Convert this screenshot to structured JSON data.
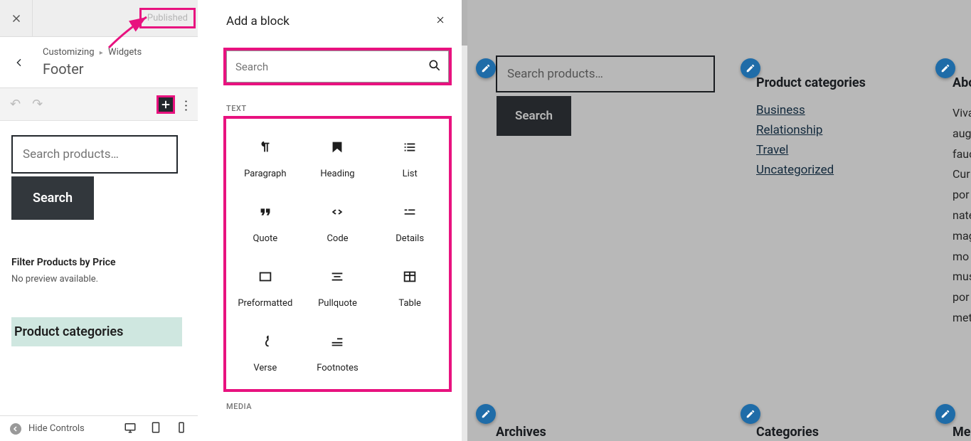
{
  "customizer": {
    "published_label": "Published",
    "breadcrumb1": "Customizing",
    "breadcrumb2": "Widgets",
    "section_title": "Footer",
    "hide_controls": "Hide Controls"
  },
  "sidebar_widgets": {
    "search_placeholder": "Search products…",
    "search_button": "Search",
    "filter_title": "Filter Products by Price",
    "filter_message": "No preview available.",
    "categories_title": "Product categories"
  },
  "block_panel": {
    "title": "Add a block",
    "search_placeholder": "Search",
    "section_text": "TEXT",
    "section_media": "MEDIA",
    "blocks": [
      {
        "name": "Paragraph",
        "icon": "paragraph"
      },
      {
        "name": "Heading",
        "icon": "heading"
      },
      {
        "name": "List",
        "icon": "list"
      },
      {
        "name": "Quote",
        "icon": "quote"
      },
      {
        "name": "Code",
        "icon": "code"
      },
      {
        "name": "Details",
        "icon": "details"
      },
      {
        "name": "Preformatted",
        "icon": "preformatted"
      },
      {
        "name": "Pullquote",
        "icon": "pullquote"
      },
      {
        "name": "Table",
        "icon": "table"
      },
      {
        "name": "Verse",
        "icon": "verse"
      },
      {
        "name": "Footnotes",
        "icon": "footnotes"
      }
    ]
  },
  "preview": {
    "search_placeholder": "Search products…",
    "search_button": "Search",
    "categories_title": "Product categories",
    "categories": [
      "Business",
      "Relationship",
      "Travel",
      "Uncategorized"
    ],
    "about_title": "Abo",
    "about_lines": [
      "Viva",
      "aug",
      "fauc",
      "Cur",
      "por",
      "nate",
      "mag",
      "mo",
      "mus",
      "por",
      "met"
    ],
    "row2": {
      "archives": "Archives",
      "categories": "Categories",
      "meta": "Me"
    }
  }
}
